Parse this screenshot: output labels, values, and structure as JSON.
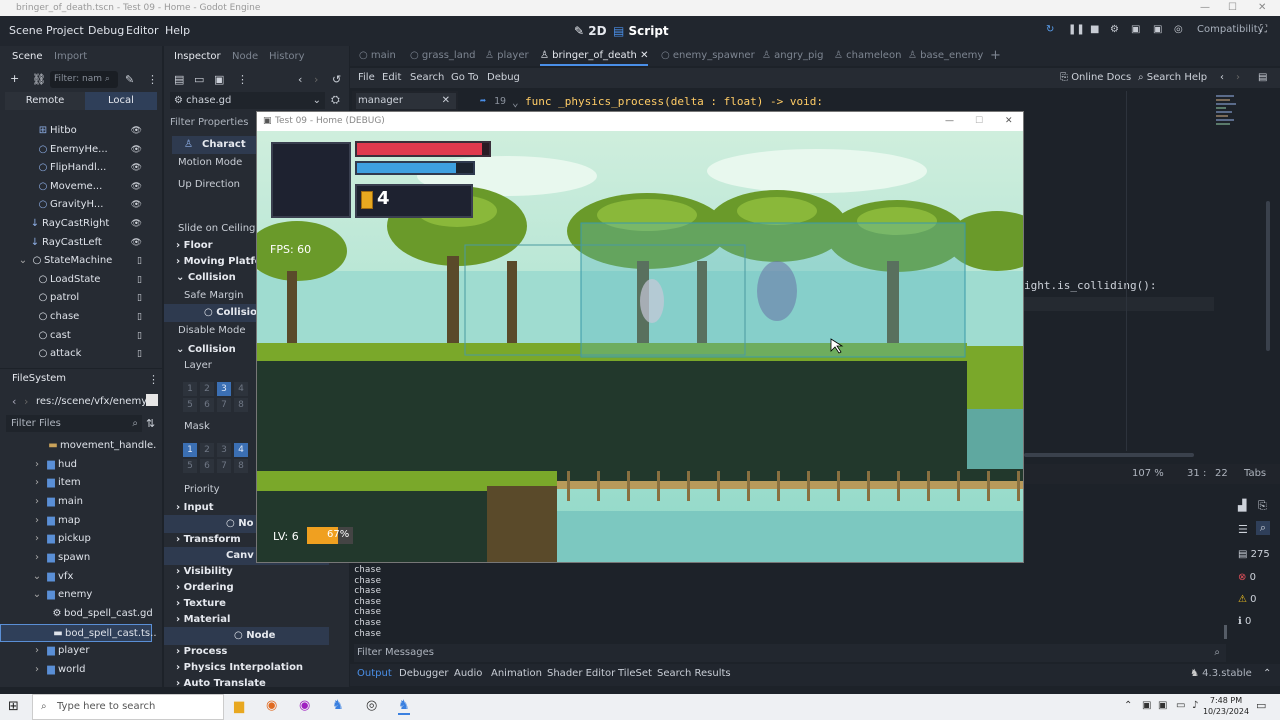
{
  "window_title": "bringer_of_death.tscn - Test 09 - Home - Godot Engine",
  "menubar": {
    "items": [
      "Scene",
      "Project",
      "Debug",
      "Editor",
      "Help"
    ],
    "workspace_2d": "2D",
    "workspace_script": "Script",
    "renderer": "Compatibility"
  },
  "scene_dock": {
    "tabs": [
      "Scene",
      "Import"
    ],
    "filter_placeholder": "Filter: nam",
    "remote_label": "Remote",
    "local_label": "Local",
    "nodes": [
      "Hitbo",
      "EnemyHe...",
      "FlipHandl...",
      "Moveme...",
      "GravityH...",
      "RayCastRight",
      "RayCastLeft",
      "StateMachine",
      "LoadState",
      "patrol",
      "chase",
      "cast",
      "attack"
    ]
  },
  "filesystem": {
    "title": "FileSystem",
    "path": "res://scene/vfx/enemy",
    "filter_placeholder": "Filter Files",
    "items": [
      "movement_handle...",
      "hud",
      "item",
      "main",
      "map",
      "pickup",
      "spawn",
      "vfx",
      "enemy",
      "bod_spell_cast.gd",
      "bod_spell_cast.ts...",
      "player",
      "world"
    ]
  },
  "inspector": {
    "tabs": [
      "Inspector",
      "Node",
      "History"
    ],
    "file": "chase.gd",
    "filter_placeholder": "Filter Properties",
    "header": "Charact",
    "rows": [
      "Motion Mode",
      "Up Direction",
      "Slide on Ceiling",
      "Floor",
      "Moving Platform",
      "Collision",
      "Safe Margin",
      "Collision",
      "Disable Mode",
      "Collision",
      "Layer",
      "Mask",
      "Priority",
      "Input",
      "Transform",
      "Visibility",
      "Ordering",
      "Texture",
      "Material",
      "Node",
      "Process",
      "Physics Interpolation",
      "Auto Translate"
    ],
    "layer_numbers": [
      "1",
      "2",
      "3",
      "4",
      "5",
      "6",
      "7",
      "8"
    ]
  },
  "script_tabs": [
    "main",
    "grass_land",
    "player",
    "bringer_of_death",
    "enemy_spawner",
    "angry_pig",
    "chameleon",
    "base_enemy"
  ],
  "script_menu": [
    "File",
    "Edit",
    "Search",
    "Go To",
    "Debug"
  ],
  "script_list_item": "manager",
  "help_links": {
    "online_docs": "Online Docs",
    "search_help": "Search Help"
  },
  "code": {
    "line_number": "19",
    "line_func": "func _physics_process(delta : float) -> void:",
    "line_colliding": "ight.is_colliding():"
  },
  "editor_status": {
    "zoom": "107 %",
    "line": "31",
    "col": "22",
    "indent": "Tabs"
  },
  "output_lines": [
    "chase",
    "chase",
    "chase",
    "chase",
    "chase",
    "chase",
    "chase"
  ],
  "output_filter_placeholder": "Filter Messages",
  "output_counts": {
    "messages": "275",
    "errors": "0",
    "warnings": "0",
    "info": "0"
  },
  "bottom_tabs": [
    "Output",
    "Debugger",
    "Audio",
    "Animation",
    "Shader Editor",
    "TileSet",
    "Search Results"
  ],
  "version": "4.3.stable",
  "game": {
    "title": "Test 09 - Home (DEBUG)",
    "fps": "FPS: 60",
    "coins": "4",
    "level": "LV: 6",
    "xp_percent": "67%",
    "xp_fraction": 0.67,
    "health_fraction": 0.95,
    "mana_fraction": 0.85
  },
  "taskbar": {
    "search_placeholder": "Type here to search",
    "time": "7:48 PM",
    "date": "10/23/2024"
  },
  "colors": {
    "accent": "#4a8fe8",
    "health": "#e03a4e",
    "mana": "#3ea0e0",
    "xp": "#f0a020"
  }
}
